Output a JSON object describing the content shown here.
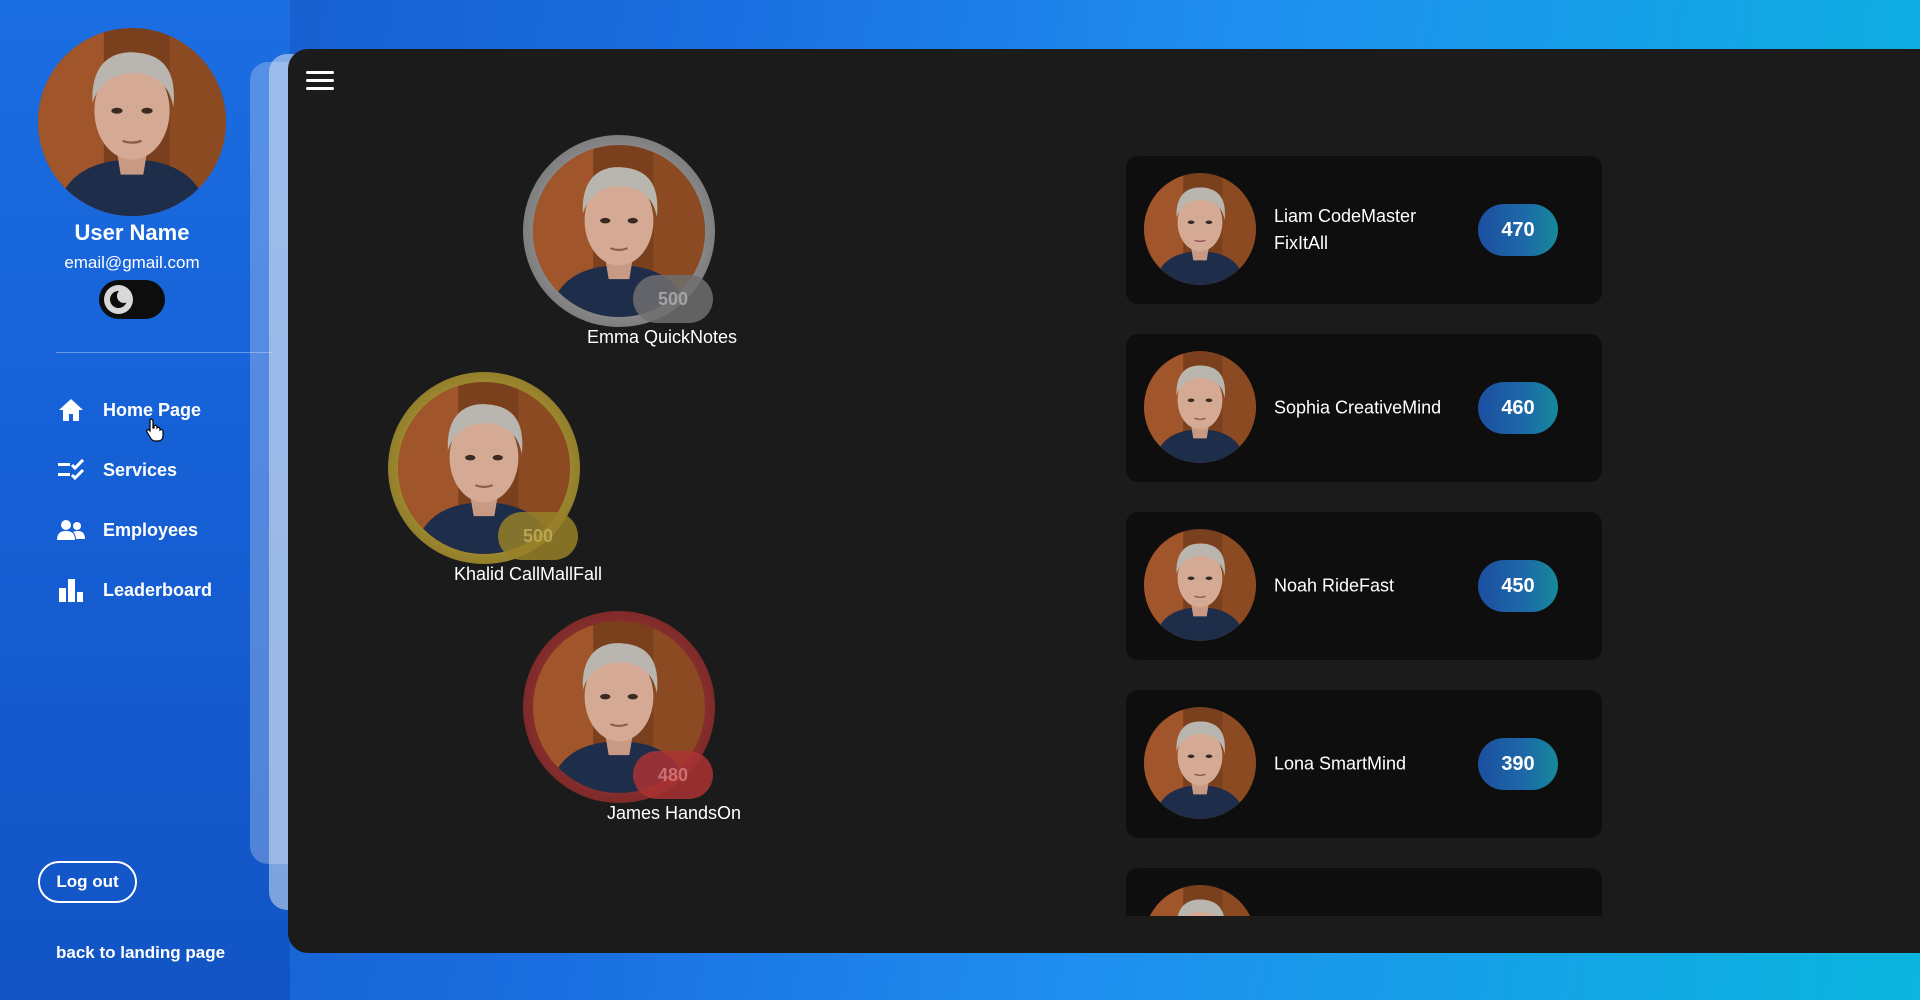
{
  "user": {
    "name": "User Name",
    "email": "email@gmail.com"
  },
  "nav": {
    "items": [
      {
        "label": "Home Page",
        "icon": "home-icon"
      },
      {
        "label": "Services",
        "icon": "checklist-icon"
      },
      {
        "label": "Employees",
        "icon": "people-icon"
      },
      {
        "label": "Leaderboard",
        "icon": "bar-chart-icon"
      }
    ]
  },
  "footer": {
    "logout_label": "Log out",
    "back_label": "back to landing page"
  },
  "podium": [
    {
      "name": "Emma QuickNotes",
      "score": "500",
      "ring": "silver"
    },
    {
      "name": "Khalid CallMallFall",
      "score": "500",
      "ring": "gold"
    },
    {
      "name": "James HandsOn",
      "score": "480",
      "ring": "red"
    }
  ],
  "leaderboard": [
    {
      "name": "Liam CodeMaster FixItAll",
      "score": "470"
    },
    {
      "name": "Sophia CreativeMind",
      "score": "460"
    },
    {
      "name": "Noah RideFast",
      "score": "450"
    },
    {
      "name": "Lona SmartMind",
      "score": "390"
    },
    {
      "name": "",
      "score": ""
    }
  ]
}
